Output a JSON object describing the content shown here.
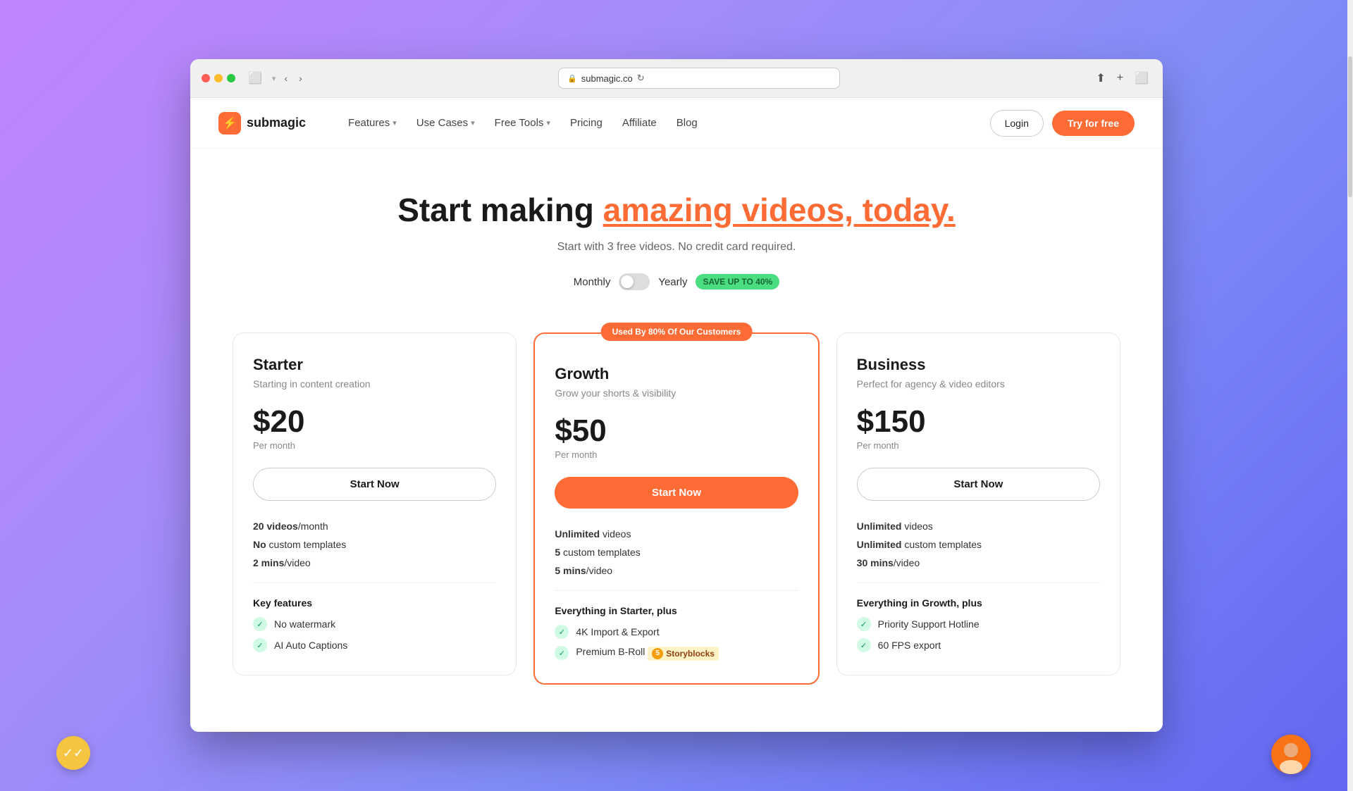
{
  "browser": {
    "url": "submagic.co",
    "refresh_label": "↻"
  },
  "navbar": {
    "logo_text": "submagic",
    "logo_icon": "⚡",
    "nav_items": [
      {
        "label": "Features",
        "has_dropdown": true
      },
      {
        "label": "Use Cases",
        "has_dropdown": true
      },
      {
        "label": "Free Tools",
        "has_dropdown": true
      },
      {
        "label": "Pricing",
        "has_dropdown": false
      },
      {
        "label": "Affiliate",
        "has_dropdown": false
      },
      {
        "label": "Blog",
        "has_dropdown": false
      }
    ],
    "login_label": "Login",
    "try_label": "Try for free"
  },
  "hero": {
    "title_start": "Start making ",
    "title_highlight": "amazing videos, today.",
    "subtitle": "Start with 3 free videos. No credit card required.",
    "billing_monthly": "Monthly",
    "billing_yearly": "Yearly",
    "save_badge": "SAVE UP TO 40%"
  },
  "pricing": {
    "featured_badge": "Used By 80% Of Our Customers",
    "plans": [
      {
        "id": "starter",
        "name": "Starter",
        "desc": "Starting in content creation",
        "price": "$20",
        "period": "Per month",
        "cta": "Start Now",
        "cta_style": "outline",
        "stats": [
          {
            "bold": "20 videos",
            "rest": "/month"
          },
          {
            "bold": "No",
            "rest": " custom templates"
          },
          {
            "bold": "2 mins",
            "rest": "/video"
          }
        ],
        "features_header": "Key features",
        "features": [
          {
            "text": "No watermark",
            "bold_part": ""
          },
          {
            "text": "AI Auto Captions",
            "bold_part": ""
          }
        ]
      },
      {
        "id": "growth",
        "name": "Growth",
        "desc": "Grow your shorts & visibility",
        "price": "$50",
        "period": "Per month",
        "cta": "Start Now",
        "cta_style": "filled",
        "stats": [
          {
            "bold": "Unlimited",
            "rest": " videos"
          },
          {
            "bold": "5",
            "rest": " custom templates"
          },
          {
            "bold": "5 mins",
            "rest": "/video"
          }
        ],
        "features_header": "Everything in Starter, plus",
        "features": [
          {
            "text": "4K Import & Export",
            "bold_part": ""
          },
          {
            "text": "Premium B-Roll",
            "bold_part": "",
            "has_storyblocks": true
          }
        ]
      },
      {
        "id": "business",
        "name": "Business",
        "desc": "Perfect for agency & video editors",
        "price": "$150",
        "period": "Per month",
        "cta": "Start Now",
        "cta_style": "outline",
        "stats": [
          {
            "bold": "Unlimited",
            "rest": " videos"
          },
          {
            "bold": "Unlimited",
            "rest": " custom templates"
          },
          {
            "bold": "30 mins",
            "rest": "/video"
          }
        ],
        "features_header": "Everything in Growth, plus",
        "features": [
          {
            "text": "Priority Support Hotline",
            "bold_part": ""
          },
          {
            "text": "60 FPS export",
            "bold_part": ""
          }
        ]
      }
    ]
  },
  "storyblocks": {
    "num": "5",
    "label": "Storyblocks"
  },
  "chat_bubble": {
    "icon": "✓✓"
  }
}
